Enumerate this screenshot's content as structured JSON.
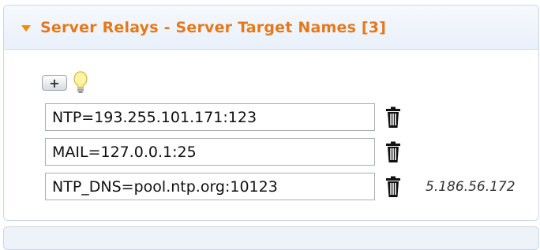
{
  "panel": {
    "title": "Server Relays - Server Target Names [3]"
  },
  "toolbar": {
    "add_label": "+",
    "icons": [
      "plus-icon",
      "lightbulb-icon"
    ]
  },
  "entries": [
    {
      "value": "NTP=193.255.101.171:123",
      "resolved": ""
    },
    {
      "value": "MAIL=127.0.0.1:25",
      "resolved": ""
    },
    {
      "value": "NTP_DNS=pool.ntp.org:10123",
      "resolved": "5.186.56.172"
    }
  ],
  "colors": {
    "title": "#e5781b",
    "caret": "#f08a00",
    "border": "#c9d6e8"
  }
}
